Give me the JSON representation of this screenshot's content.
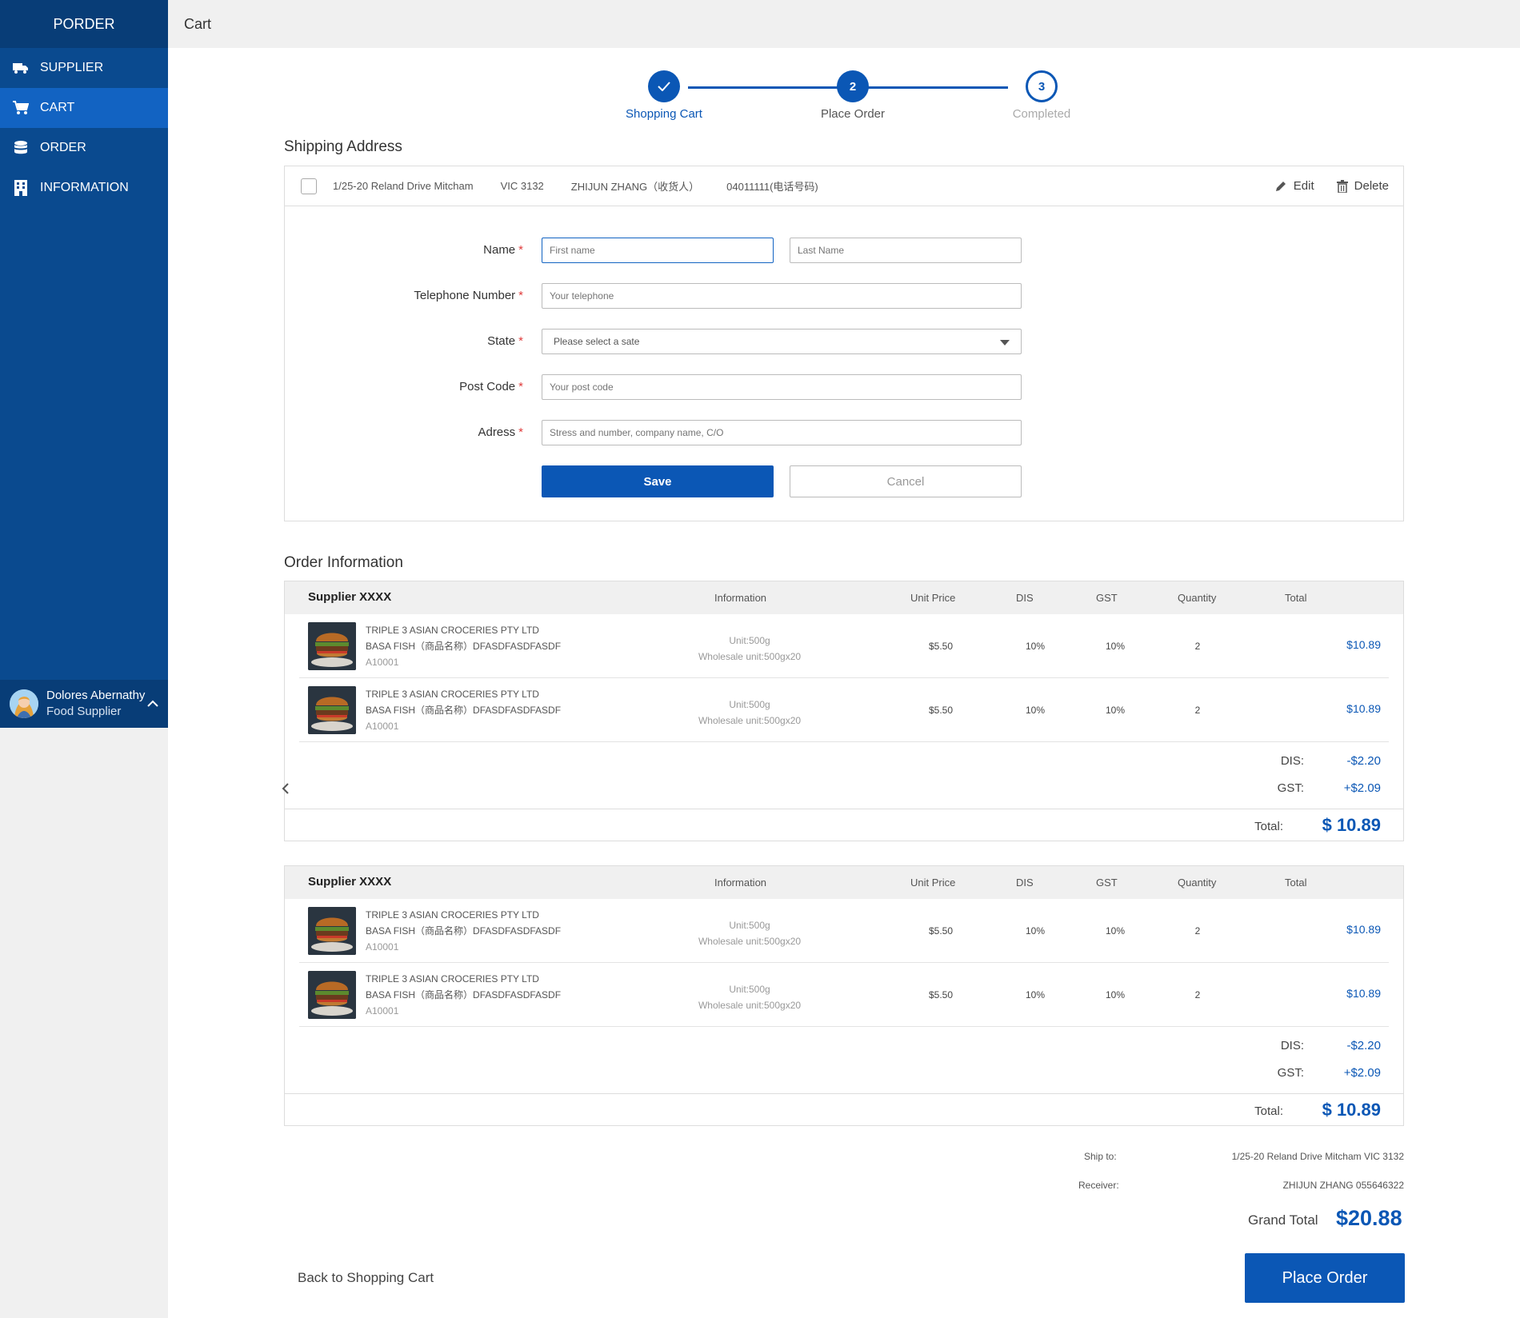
{
  "sidebar": {
    "brand": "PORDER",
    "items": [
      {
        "label": "SUPPLIER"
      },
      {
        "label": "CART"
      },
      {
        "label": "ORDER"
      },
      {
        "label": "INFORMATION"
      }
    ],
    "user": {
      "name": "Dolores Abernathy",
      "role": "Food Supplier"
    }
  },
  "topbar": {
    "title": "Cart"
  },
  "stepper": {
    "steps": [
      {
        "num": "",
        "label": "Shopping Cart"
      },
      {
        "num": "2",
        "label": "Place Order"
      },
      {
        "num": "3",
        "label": "Completed"
      }
    ]
  },
  "shipping": {
    "title": "Shipping Address",
    "address": {
      "street": "1/25-20 Reland Drive Mitcham",
      "state": "VIC 3132",
      "receiver": "ZHIJUN ZHANG（收货人）",
      "phone": "04011111(电话号码)"
    },
    "edit_label": "Edit",
    "delete_label": "Delete",
    "form": {
      "name_label": "Name",
      "first_placeholder": "First name",
      "last_placeholder": "Last Name",
      "tel_label": "Telephone Number",
      "tel_placeholder": "Your telephone",
      "state_label": "State",
      "state_placeholder": "Please select a sate",
      "postcode_label": "Post Code",
      "postcode_placeholder": "Your post code",
      "address_label": "Adress",
      "address_placeholder": "Stress and number, company name, C/O",
      "required_mark": "*",
      "save_label": "Save",
      "cancel_label": "Cancel"
    }
  },
  "order": {
    "title": "Order Information",
    "columns": {
      "info": "Information",
      "unit_price": "Unit Price",
      "dis": "DIS",
      "gst": "GST",
      "quantity": "Quantity",
      "total": "Total"
    },
    "suppliers": [
      {
        "name": "Supplier XXXX",
        "items": [
          {
            "company": "TRIPLE 3 ASIAN CROCERIES PTY LTD",
            "product": "BASA  FISH（商品名称）DFASDFASDFASDF",
            "sku": "A10001",
            "unit": "Unit:500g",
            "wholesale": "Wholesale unit:500gx20",
            "price": "$5.50",
            "dis": "10%",
            "gst": "10%",
            "qty": "2",
            "total": "$10.89"
          },
          {
            "company": "TRIPLE 3 ASIAN CROCERIES PTY LTD",
            "product": "BASA  FISH（商品名称）DFASDFASDFASDF",
            "sku": "A10001",
            "unit": "Unit:500g",
            "wholesale": "Wholesale unit:500gx20",
            "price": "$5.50",
            "dis": "10%",
            "gst": "10%",
            "qty": "2",
            "total": "$10.89"
          }
        ],
        "dis_label": "DIS:",
        "dis_value": "-$2.20",
        "gst_label": "GST:",
        "gst_value": "+$2.09",
        "total_label": "Total:",
        "total_value": "$ 10.89"
      },
      {
        "name": "Supplier XXXX",
        "items": [
          {
            "company": "TRIPLE 3 ASIAN CROCERIES PTY LTD",
            "product": "BASA  FISH（商品名称）DFASDFASDFASDF",
            "sku": "A10001",
            "unit": "Unit:500g",
            "wholesale": "Wholesale unit:500gx20",
            "price": "$5.50",
            "dis": "10%",
            "gst": "10%",
            "qty": "2",
            "total": "$10.89"
          },
          {
            "company": "TRIPLE 3 ASIAN CROCERIES PTY LTD",
            "product": "BASA  FISH（商品名称）DFASDFASDFASDF",
            "sku": "A10001",
            "unit": "Unit:500g",
            "wholesale": "Wholesale unit:500gx20",
            "price": "$5.50",
            "dis": "10%",
            "gst": "10%",
            "qty": "2",
            "total": "$10.89"
          }
        ],
        "dis_label": "DIS:",
        "dis_value": "-$2.20",
        "gst_label": "GST:",
        "gst_value": "+$2.09",
        "total_label": "Total:",
        "total_value": "$ 10.89"
      }
    ]
  },
  "summary": {
    "ship_to_label": "Ship to:",
    "ship_to_value": "1/25-20 Reland Drive Mitcham VIC 3132",
    "receiver_label": "Receiver:",
    "receiver_value": "ZHIJUN ZHANG  055646322",
    "grand_total_label": "Grand Total",
    "grand_total_value": "$20.88"
  },
  "footer": {
    "back_label": "Back to Shopping Cart",
    "place_order_label": "Place Order"
  },
  "colors": {
    "primary": "#0b57b5",
    "sidebar": "#0a4a8f",
    "active": "#1263c2"
  }
}
